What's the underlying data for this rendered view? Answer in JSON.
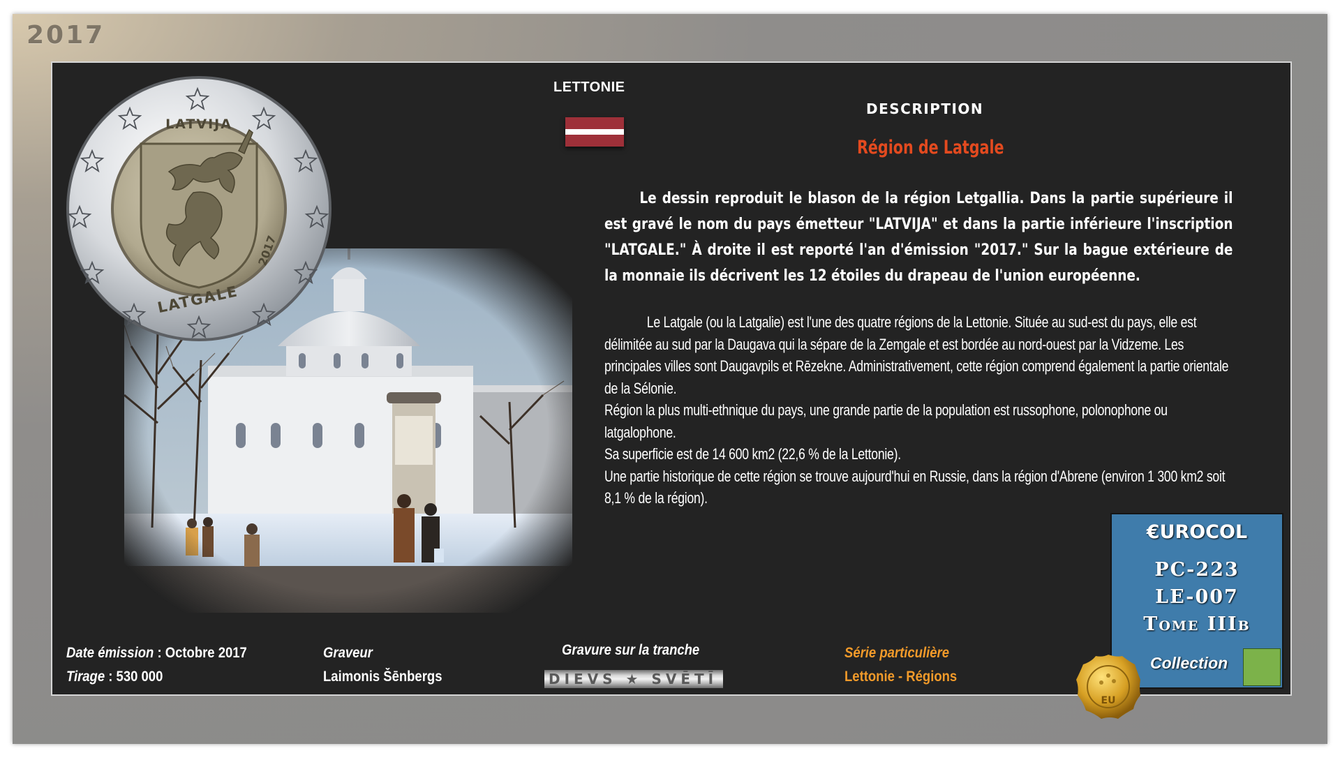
{
  "year": "2017",
  "country": "LETTONIE",
  "coin": {
    "country_inscription": "LATVIJA",
    "region_inscription": "LATGALE",
    "year_inscription": "2017"
  },
  "description": {
    "heading": "DESCRIPTION",
    "title": "Région de Latgale",
    "paragraph1": "Le dessin reproduit le blason de la région Letgallia. Dans la partie supérieure il est gravé le nom du pays émetteur \"LATVIJA\" et dans la partie inférieure l'inscription \"LATGALE.\" À droite il est reporté l'an d'émission \"2017.\" Sur la bague extérieure de la monnaie ils décrivent les 12 étoiles du drapeau de l'union européenne.",
    "paragraph2_lines": [
      "Le Latgale (ou la Latgalie) est l'une des quatre régions de la Lettonie. Située au sud-est du pays, elle est délimitée au sud par la Daugava qui la sépare de la Zemgale et est bordée au nord-ouest par la Vidzeme. Les principales villes sont Daugavpils et Rēzekne. Administrativement, cette région comprend également la partie orientale de la Sélonie.",
      "Région la plus multi-ethnique du pays, une grande partie de la population est russophone, polonophone ou latgalophone.",
      "Sa superficie est de 14  600 km2 (22,6  % de la Lettonie).",
      "Une partie historique de cette région se trouve aujourd'hui en Russie, dans la région d'Abrene (environ 1  300 km2 soit 8,1  % de la région)."
    ]
  },
  "footer": {
    "date_label": "Date émission",
    "date_value": " : Octobre 2017",
    "tirage_label": "Tirage",
    "tirage_value": " : 530 000",
    "graveur_label": "Graveur",
    "graveur_name": "Laimonis Šēnbergs",
    "tranche_label": "Gravure sur la tranche",
    "tranche_text": "DIEVS ★ SVĒTĪ",
    "serie_label": "Série particulière",
    "serie_value": "Lettonie - Régions"
  },
  "catalog": {
    "brand": "€UROCOL",
    "codes": [
      "PC-223",
      "LE-007",
      "Tome IIIb"
    ],
    "collection": "Collection",
    "seal_text": "EU"
  },
  "colors": {
    "panel": "#232323",
    "accent_red": "#e34a1f",
    "accent_orange": "#f19a2a",
    "catalog_blue": "#3f7cab",
    "catalog_green": "#7cb24a",
    "flag_red": "#9e3039"
  },
  "icons": {
    "coin": "latvia-2-euro-coin",
    "flag": "latvia-flag",
    "photo": "cathedral-winter-photo",
    "seal": "gold-wax-seal"
  }
}
